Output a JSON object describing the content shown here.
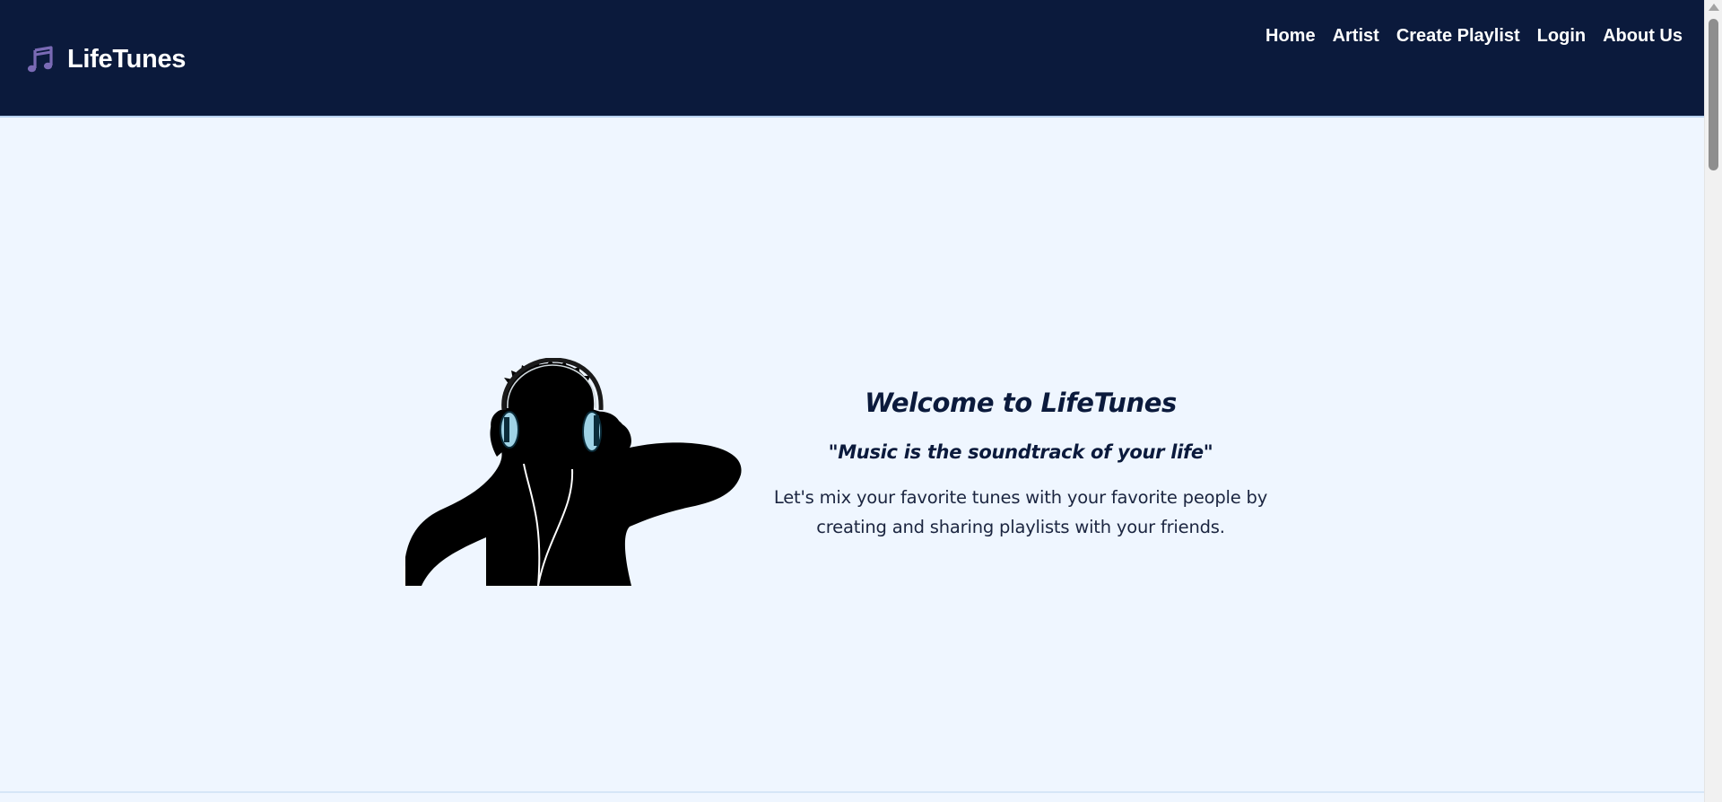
{
  "app": {
    "brand_name": "LifeTunes",
    "brand_icon": "music-notes-icon"
  },
  "nav": {
    "items": [
      {
        "label": "Home"
      },
      {
        "label": "Artist"
      },
      {
        "label": "Create Playlist"
      },
      {
        "label": "Login"
      },
      {
        "label": "About Us"
      }
    ]
  },
  "hero": {
    "title": "Welcome to LifeTunes",
    "quote": "\"Music is the soundtrack of your life\"",
    "description": "Let's mix your favorite tunes with your favorite people by creating and sharing playlists with your friends.",
    "image": "person-with-headphones-silhouette"
  },
  "colors": {
    "header_bg": "#0b1a3c",
    "page_bg": "#eff6ff",
    "brand_icon": "#7a6ab5",
    "text_dark": "#0b1a3c",
    "headphone_accent": "#9fd3e6"
  }
}
